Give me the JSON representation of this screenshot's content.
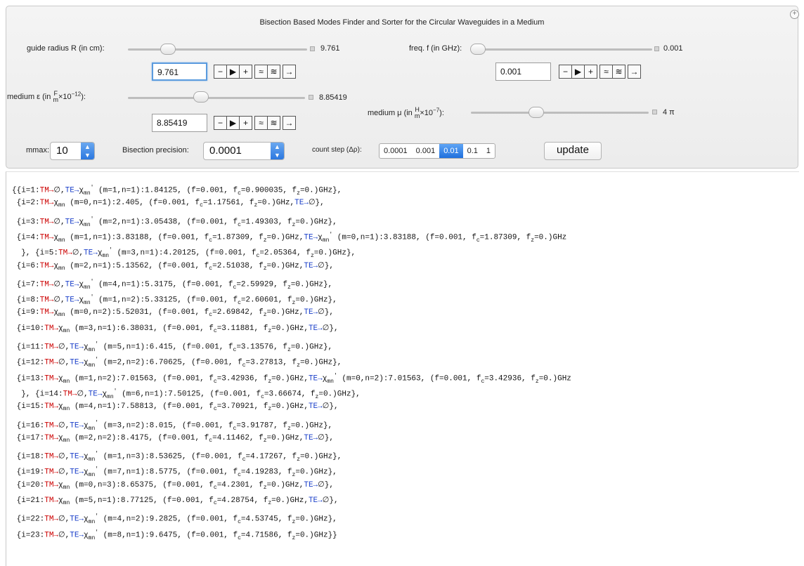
{
  "title": "Bisection Based Modes Finder and Sorter for the Circular Waveguides in a Medium",
  "controls": {
    "radius": {
      "label": "guide radius R (in cm):",
      "value": "9.761",
      "input": "9.761",
      "position": 0.12
    },
    "freq": {
      "label": "freq. f (in GHz):",
      "value": "0.001",
      "input": "0.001",
      "position": 0.0
    },
    "eps": {
      "label_pre": "medium ε (in",
      "frac_num": "F",
      "frac_den": "m",
      "label_post": "×10",
      "exp": "−12",
      "label_end": "):",
      "value": "8.85419",
      "input": "8.85419",
      "position": 0.39
    },
    "mu": {
      "label_pre": "medium μ (in",
      "frac_num": "H",
      "frac_den": "m",
      "label_post": "×10",
      "exp": "−7",
      "label_end": "):",
      "value": "4 π",
      "position": 0.39
    },
    "buttons": {
      "minus": "−",
      "play": "▶",
      "plus": "+",
      "faster": "≈",
      "slower": "≋",
      "step": "→"
    },
    "mmax": {
      "label": "mmax:",
      "value": "10"
    },
    "precision": {
      "label": "Bisection precision:",
      "value": "0.0001"
    },
    "countstep": {
      "label": "count step (Δρ):",
      "options": [
        "0.0001",
        "0.001",
        "0.01",
        "0.1",
        "1"
      ],
      "selected": "0.01"
    },
    "update_label": "update"
  },
  "results": [
    {
      "i": "1",
      "tm": "∅",
      "te": "χ'mn (m=1,n=1):1.84125, (f=0.001, fc=0.900035, fz=0.)GHz"
    },
    {
      "i": "2",
      "tm": "χmn (m=0,n=1):2.405, (f=0.001, fc=1.17561, fz=0.)GHz",
      "te": "∅"
    },
    {
      "i": "3",
      "tm": "∅",
      "te": "χ'mn (m=2,n=1):3.05438, (f=0.001, fc=1.49303, fz=0.)GHz"
    }
  ],
  "output_lines": [
    "{{i=1:TM→∅,TE→χ'mn (m=1,n=1):1.84125, (f=0.001, fc=0.900035, fz=0.)GHz},",
    " {i=2:TM→χmn (m=0,n=1):2.405, (f=0.001, fc=1.17561, fz=0.)GHz,TE→∅},",
    " {i=3:TM→∅,TE→χ'mn (m=2,n=1):3.05438, (f=0.001, fc=1.49303, fz=0.)GHz},",
    " {i=4:TM→χmn (m=1,n=1):3.83188, (f=0.001, fc=1.87309, fz=0.)GHz,TE→χ'mn (m=0,n=1):3.83188, (f=0.001, fc=1.87309, fz=0.)GHz",
    "  }, {i=5:TM→∅,TE→χ'mn (m=3,n=1):4.20125, (f=0.001, fc=2.05364, fz=0.)GHz},",
    " {i=6:TM→χmn (m=2,n=1):5.13562, (f=0.001, fc=2.51038, fz=0.)GHz,TE→∅},",
    " {i=7:TM→∅,TE→χ'mn (m=4,n=1):5.3175, (f=0.001, fc=2.59929, fz=0.)GHz},",
    " {i=8:TM→∅,TE→χ'mn (m=1,n=2):5.33125, (f=0.001, fc=2.60601, fz=0.)GHz},",
    " {i=9:TM→χmn (m=0,n=2):5.52031, (f=0.001, fc=2.69842, fz=0.)GHz,TE→∅},",
    " {i=10:TM→χmn (m=3,n=1):6.38031, (f=0.001, fc=3.11881, fz=0.)GHz,TE→∅},",
    " {i=11:TM→∅,TE→χ'mn (m=5,n=1):6.415, (f=0.001, fc=3.13576, fz=0.)GHz},",
    " {i=12:TM→∅,TE→χ'mn (m=2,n=2):6.70625, (f=0.001, fc=3.27813, fz=0.)GHz},",
    " {i=13:TM→χmn (m=1,n=2):7.01563, (f=0.001, fc=3.42936, fz=0.)GHz,TE→χ'mn (m=0,n=2):7.01563, (f=0.001, fc=3.42936, fz=0.)GHz",
    "  }, {i=14:TM→∅,TE→χ'mn (m=6,n=1):7.50125, (f=0.001, fc=3.66674, fz=0.)GHz},",
    " {i=15:TM→χmn (m=4,n=1):7.58813, (f=0.001, fc=3.70921, fz=0.)GHz,TE→∅},",
    " {i=16:TM→∅,TE→χ'mn (m=3,n=2):8.015, (f=0.001, fc=3.91787, fz=0.)GHz},",
    " {i=17:TM→χmn (m=2,n=2):8.4175, (f=0.001, fc=4.11462, fz=0.)GHz,TE→∅},",
    " {i=18:TM→∅,TE→χ'mn (m=1,n=3):8.53625, (f=0.001, fc=4.17267, fz=0.)GHz},",
    " {i=19:TM→∅,TE→χ'mn (m=7,n=1):8.5775, (f=0.001, fc=4.19283, fz=0.)GHz},",
    " {i=20:TM→χmn (m=0,n=3):8.65375, (f=0.001, fc=4.2301, fz=0.)GHz,TE→∅},",
    " {i=21:TM→χmn (m=5,n=1):8.77125, (f=0.001, fc=4.28754, fz=0.)GHz,TE→∅},",
    " {i=22:TM→∅,TE→χ'mn (m=4,n=2):9.2825, (f=0.001, fc=4.53745, fz=0.)GHz},",
    " {i=23:TM→∅,TE→χ'mn (m=8,n=1):9.6475, (f=0.001, fc=4.71586, fz=0.)GHz}}"
  ]
}
